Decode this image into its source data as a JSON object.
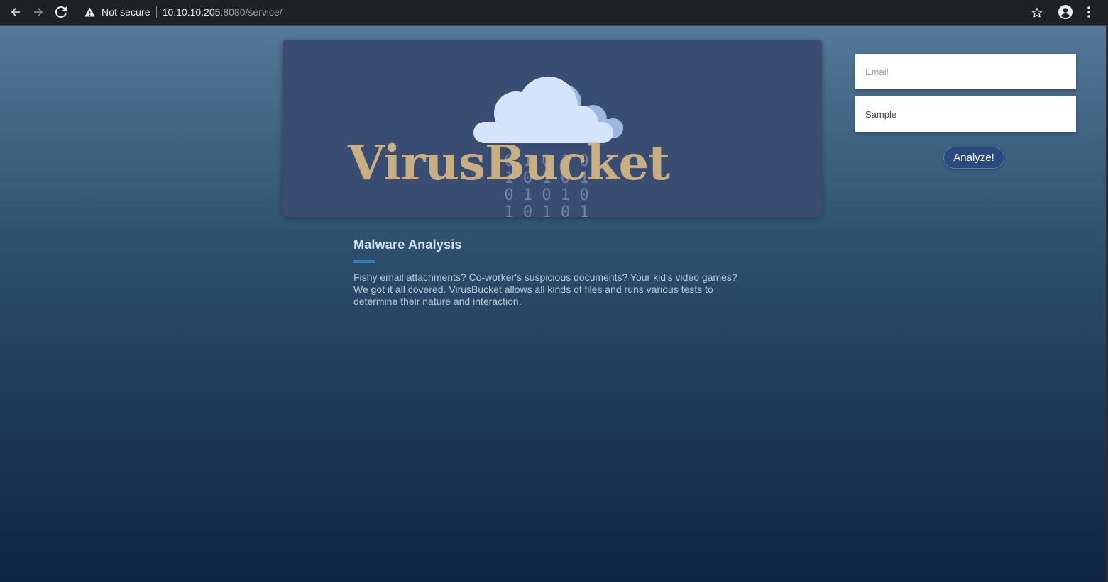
{
  "browser": {
    "security_label": "Not secure",
    "url_host": "10.10.10.205",
    "url_path": ":8080/service/"
  },
  "banner": {
    "brand": "VirusBucket",
    "binary_rows": [
      "0 1 0 1 0",
      "1 0 1 0 1",
      "0 1 0 1 0",
      "1 0 1 0 1"
    ]
  },
  "article": {
    "title": "Malware Analysis",
    "body": "Fishy email attachments? Co-worker's suspicious documents? Your kid's video games? We got it all covered. VirusBucket allows all kinds of files and runs various tests to determine their nature and interaction."
  },
  "form": {
    "email_placeholder": "Email",
    "sample_placeholder": "Sample",
    "submit_label": "Analyze!"
  },
  "colors": {
    "brand": "#c8ae82",
    "banner_bg": "#394c72",
    "accent": "#2e7bb8",
    "button_bg": "#2a4a7c"
  }
}
